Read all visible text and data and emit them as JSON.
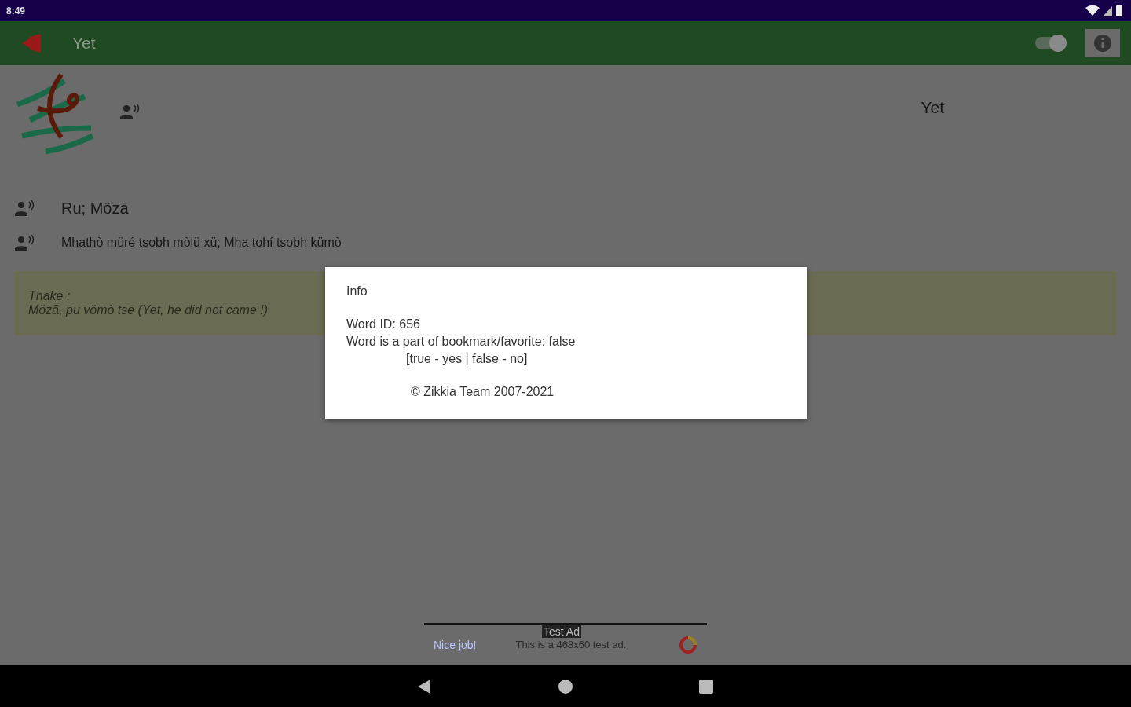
{
  "status_bar": {
    "time": "8:49"
  },
  "app_bar": {
    "title": "Yet",
    "toggle": {
      "on": true
    }
  },
  "word": {
    "heading": "Yet"
  },
  "lines": [
    {
      "kind": "title",
      "text": "Ru; Mözā"
    },
    {
      "kind": "sentence",
      "text": "Mhathò müré tsobh mòlü xü; Mha tohí tsobh kümò"
    }
  ],
  "example": {
    "label": "Thake :",
    "text": "Mözā, pu vömò tse (Yet, he did not came !)"
  },
  "dialog": {
    "title": "Info",
    "lines": [
      {
        "kind": "plain",
        "text": "Word ID: 656"
      },
      {
        "kind": "plain",
        "text": "Word is a part of bookmark/favorite: false"
      },
      {
        "kind": "indent",
        "text": "[true - yes | false - no]"
      },
      {
        "kind": "gap",
        "text": "© Zikkia Team 2007-2021"
      }
    ]
  },
  "ad": {
    "badge": "Test Ad",
    "link": "Nice job!",
    "text": "This is a 468x60 test ad."
  }
}
